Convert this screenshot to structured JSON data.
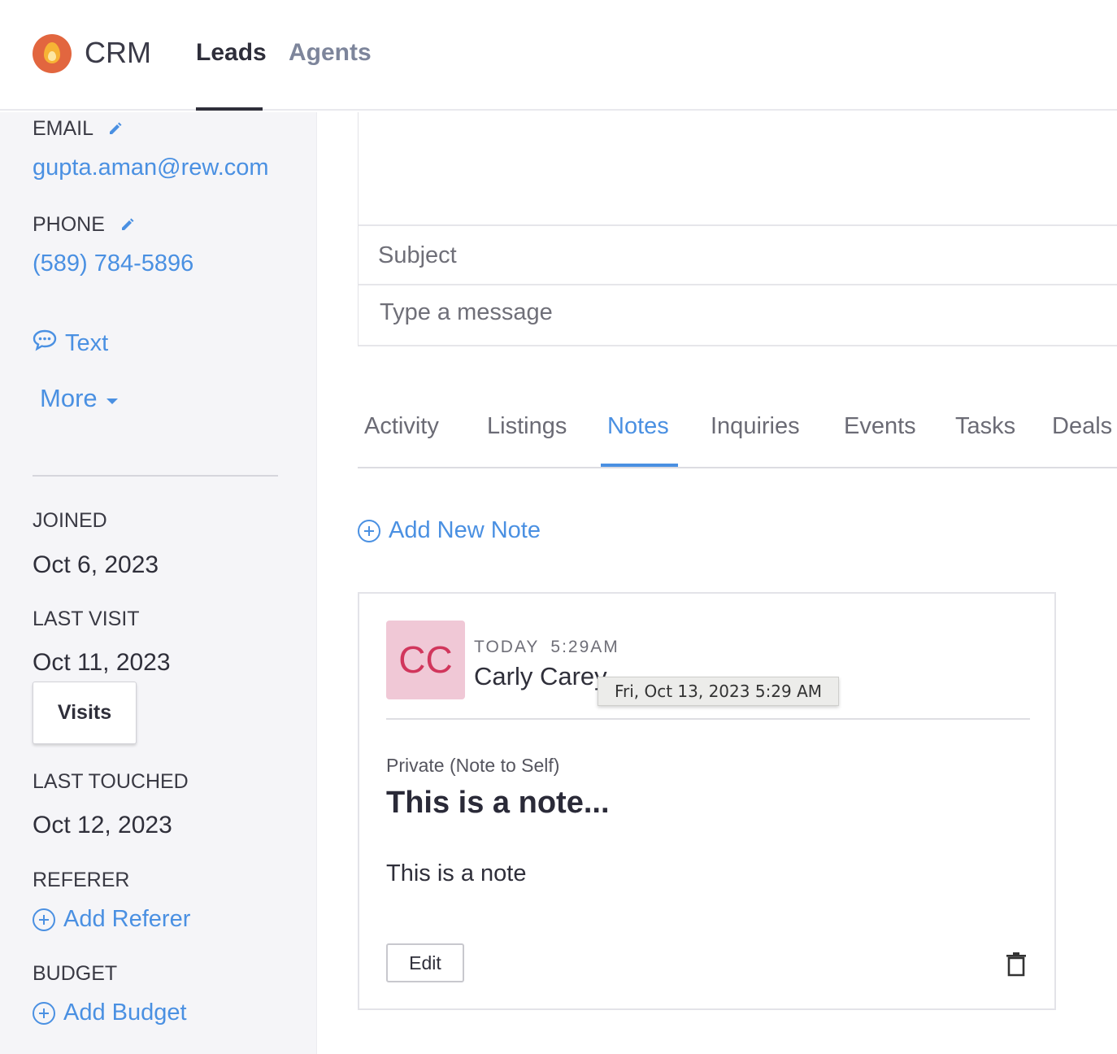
{
  "header": {
    "app_name": "CRM",
    "tabs": [
      "Leads",
      "Agents"
    ],
    "active_tab": "Leads"
  },
  "sidebar": {
    "email_label": "EMAIL",
    "email": "gupta.aman@rew.com",
    "phone_label": "PHONE",
    "phone": "(589) 784-5896",
    "text_action": "Text",
    "more_action": "More",
    "joined_label": "JOINED",
    "joined": "Oct 6, 2023",
    "last_visit_label": "LAST VISIT",
    "last_visit": "Oct 11, 2023",
    "visits_button": "Visits",
    "last_touched_label": "LAST TOUCHED",
    "last_touched": "Oct 12, 2023",
    "referer_label": "REFERER",
    "add_referer": "Add Referer",
    "budget_label": "BUDGET",
    "add_budget": "Add Budget"
  },
  "composer": {
    "subject_placeholder": "Subject",
    "message_placeholder": "Type a message"
  },
  "tabs": {
    "items": [
      "Activity",
      "Listings",
      "Notes",
      "Inquiries",
      "Events",
      "Tasks",
      "Deals"
    ],
    "active": "Notes"
  },
  "notes": {
    "add_new": "Add New Note",
    "card": {
      "avatar_initials": "CC",
      "day": "TODAY",
      "time": "5:29AM",
      "author": "Carly Carey",
      "privacy": "Private (Note to Self)",
      "title": "This is a note...",
      "body": "This is a note",
      "edit_label": "Edit"
    },
    "tooltip": "Fri, Oct 13, 2023 5:29 AM"
  },
  "colors": {
    "accent": "#4a90e2",
    "avatar_bg": "#f0c8d6",
    "avatar_text": "#d1365c",
    "logo": "#e2663f"
  },
  "icons": [
    "pencil-icon",
    "chat-bubble-icon",
    "caret-down-icon",
    "plus-circle-icon",
    "trash-icon",
    "flame-logo-icon"
  ]
}
